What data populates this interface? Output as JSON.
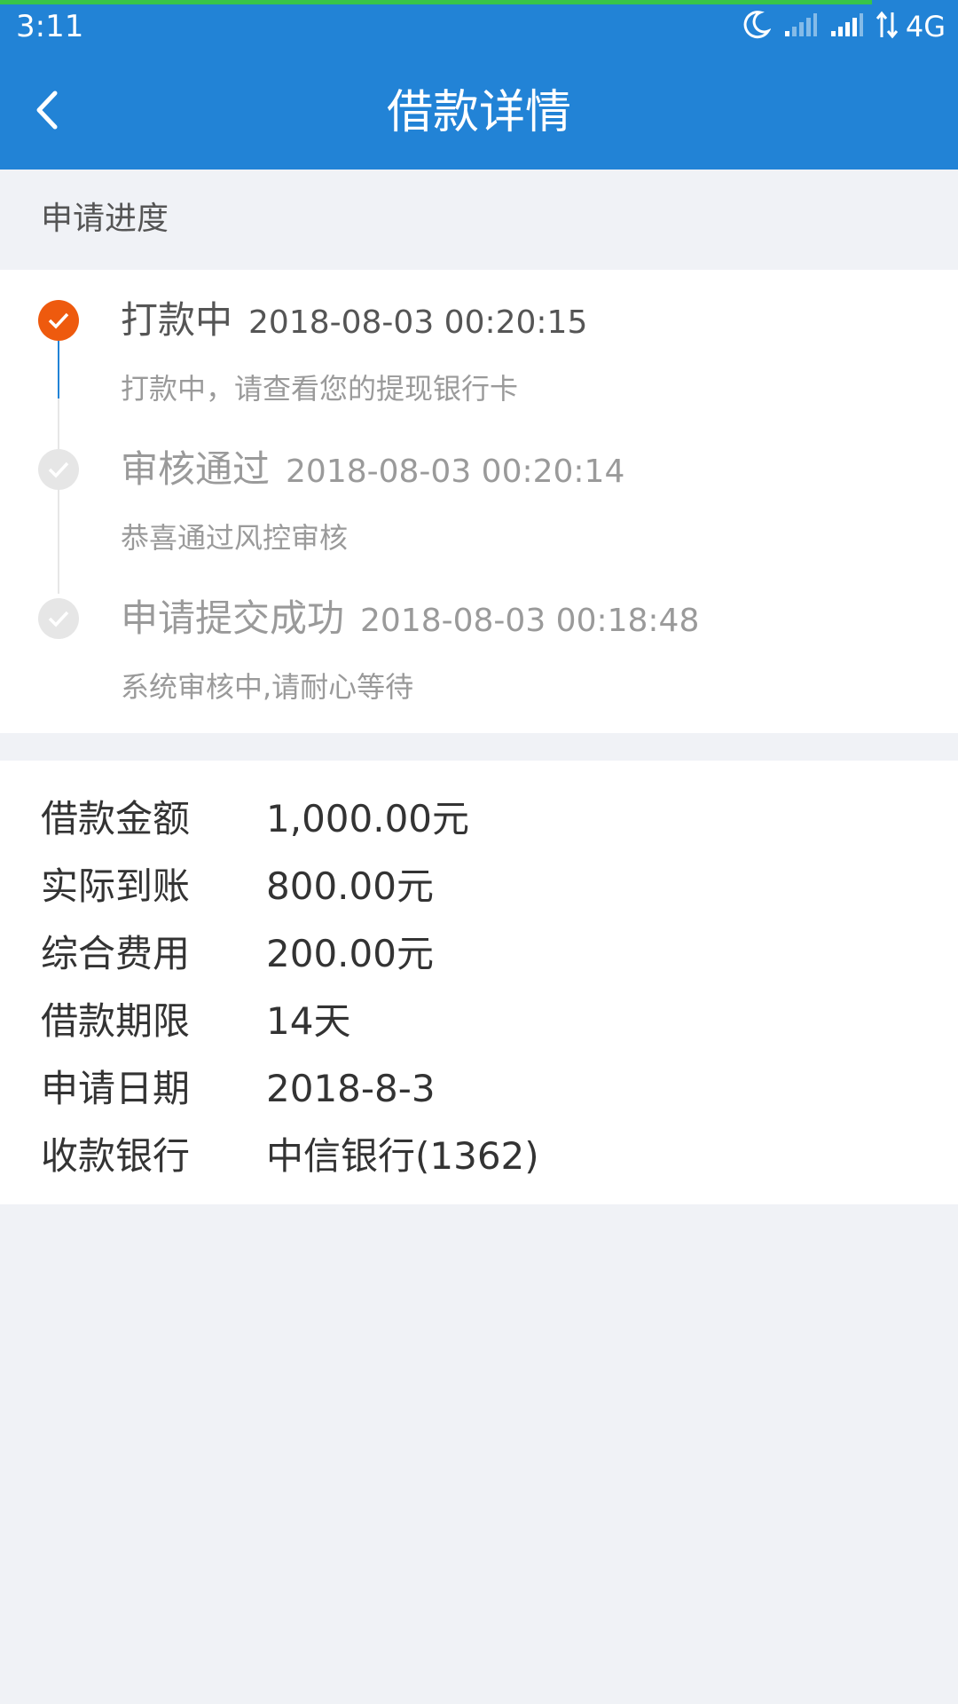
{
  "status_bar": {
    "time": "3:11",
    "network": "4G",
    "icons": [
      "moon-icon",
      "signal-weak-icon",
      "signal-strong-icon",
      "data-arrows-icon"
    ]
  },
  "load_progress": 0.91,
  "header": {
    "title": "借款详情",
    "back_icon": "chevron-left-icon"
  },
  "progress_section": {
    "title": "申请进度",
    "steps": [
      {
        "status": "打款中",
        "time": "2018-08-03 00:20:15",
        "description": "打款中，请查看您的提现银行卡",
        "state": "current"
      },
      {
        "status": "审核通过",
        "time": "2018-08-03 00:20:14",
        "description": "恭喜通过风控审核",
        "state": "done"
      },
      {
        "status": "申请提交成功",
        "time": "2018-08-03 00:18:48",
        "description": "系统审核中,请耐心等待",
        "state": "done"
      }
    ]
  },
  "details": [
    {
      "label": "借款金额",
      "value": "1,000.00元"
    },
    {
      "label": "实际到账",
      "value": "800.00元"
    },
    {
      "label": "综合费用",
      "value": "200.00元"
    },
    {
      "label": "借款期限",
      "value": "14天"
    },
    {
      "label": "申请日期",
      "value": "2018-8-3"
    },
    {
      "label": "收款银行",
      "value": "中信银行(1362)"
    }
  ],
  "colors": {
    "header_bg": "#2283d6",
    "load_progress": "#38c44a",
    "active_step": "#ee5a0e",
    "inactive_step": "#e6e6e6",
    "timeline_active_line": "#2283d6",
    "page_bg": "#f0f2f6"
  }
}
